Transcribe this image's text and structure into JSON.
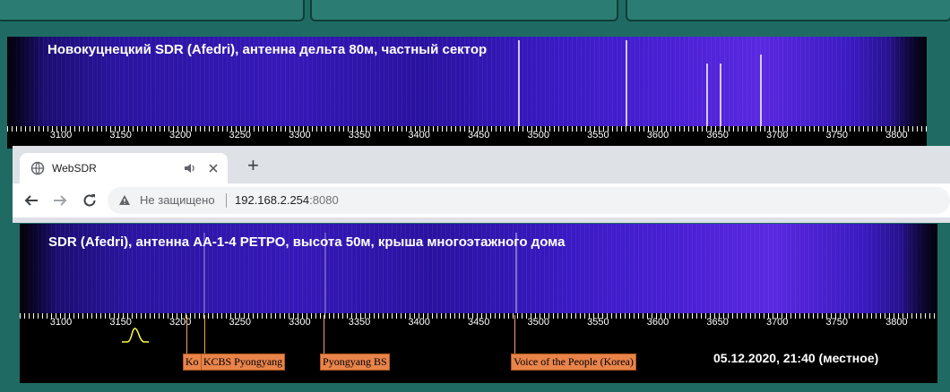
{
  "top_sdr": {
    "title": "Новокуцнецкий SDR (Afedri), антенна дельта 80м, частный сектор",
    "ticks": [
      "3100",
      "3150",
      "3200",
      "3250",
      "3300",
      "3350",
      "3400",
      "3450",
      "3500",
      "3550",
      "3600",
      "3650",
      "3700",
      "3750",
      "3800"
    ]
  },
  "browser": {
    "tab_title": "WebSDR",
    "new_tab_symbol": "+",
    "security_text": "Не защищено",
    "url_host": "192.168.2.254",
    "url_port": ":8080"
  },
  "bottom_sdr": {
    "title": "SDR (Afedri), антенна АА-1-4 РЕТРО, высота 50м, крыша многоэтажного дома",
    "ticks": [
      "3100",
      "3150",
      "3200",
      "3250",
      "3300",
      "3350",
      "3400",
      "3450",
      "3500",
      "3550",
      "3600",
      "3650",
      "3700",
      "3750",
      "3800"
    ],
    "station_labels": [
      {
        "label": "Ko",
        "freq": "3205"
      },
      {
        "label": "KCBS Pyongyang",
        "freq": "3220"
      },
      {
        "label": "Pyongyang BS",
        "freq": "3320"
      },
      {
        "label": "Voice of the People (Korea)",
        "freq": "3480"
      }
    ],
    "datetime": "05.12.2020, 21:40 (местное)"
  }
}
